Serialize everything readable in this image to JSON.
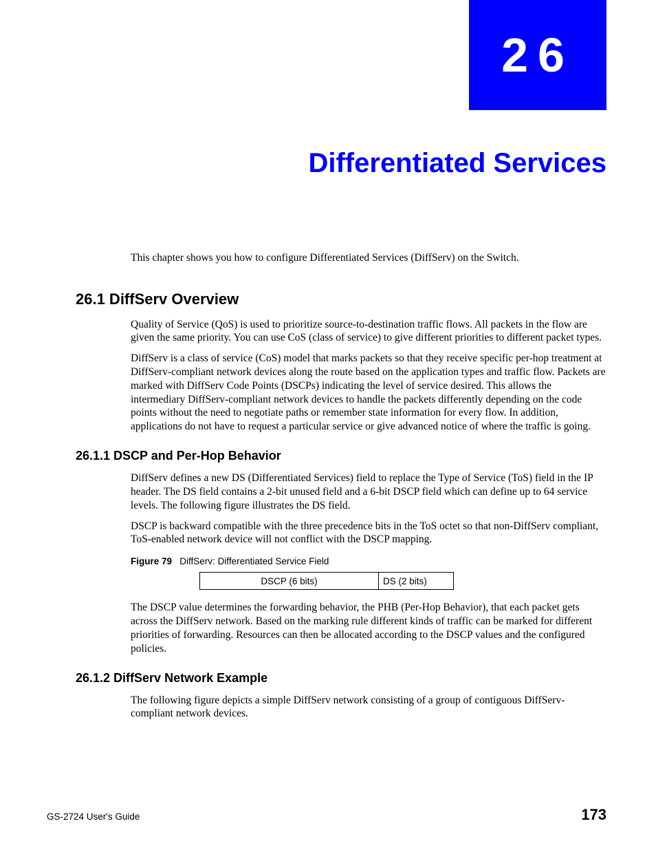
{
  "chapter": {
    "number": "26",
    "title": "Differentiated Services"
  },
  "intro": "This chapter shows you how to configure Differentiated Services (DiffServ) on the Switch.",
  "sections": {
    "s26_1": {
      "heading": "26.1  DiffServ Overview",
      "p1": "Quality of Service (QoS) is used to prioritize source-to-destination traffic flows. All packets in the flow are given the same priority. You can use CoS (class of service) to give different priorities to different packet types.",
      "p2": "DiffServ is a class of service (CoS) model that marks packets so that they receive specific per-hop treatment at DiffServ-compliant network devices along the route based on the application types and traffic flow. Packets are marked with DiffServ Code Points (DSCPs) indicating the level of service desired. This allows the intermediary DiffServ-compliant network devices to handle the packets differently depending on the code points without the need to negotiate paths or remember state information for every flow. In addition, applications do not have to request a particular service or give advanced notice of where the traffic is going."
    },
    "s26_1_1": {
      "heading": "26.1.1  DSCP and Per-Hop Behavior",
      "p1": "DiffServ defines a new DS (Differentiated Services) field to replace the Type of Service (ToS) field in the IP header. The DS field contains a 2-bit unused field and a 6-bit DSCP field which can define up to 64 service levels. The following figure illustrates the DS field.",
      "p2": "DSCP is backward compatible with the three precedence bits in the ToS octet so that non-DiffServ compliant, ToS-enabled network device will not conflict with the DSCP mapping.",
      "figure": {
        "label": "Figure 79",
        "caption": "DiffServ: Differentiated Service Field",
        "cells": {
          "dscp": "DSCP (6 bits)",
          "ds": "DS (2 bits)"
        }
      },
      "p3": "The DSCP value determines the forwarding behavior, the PHB (Per-Hop Behavior), that each packet gets across the DiffServ network.  Based on the marking rule different kinds of traffic can be marked for different priorities of forwarding. Resources can then be allocated according to the DSCP values and the configured policies."
    },
    "s26_1_2": {
      "heading": "26.1.2  DiffServ Network Example",
      "p1": "The following figure depicts a simple DiffServ network consisting of a group of contiguous DiffServ-compliant network devices."
    }
  },
  "footer": {
    "guide": "GS-2724 User's Guide",
    "page": "173"
  }
}
